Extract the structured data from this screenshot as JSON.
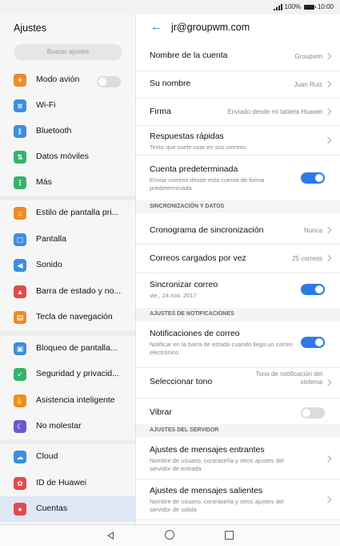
{
  "status": {
    "battery": "100%",
    "time": "10:00"
  },
  "left": {
    "title": "Ajustes",
    "search_placeholder": "Buscar ajustes",
    "items": [
      {
        "label": "Modo avión",
        "icon": "airplane-icon",
        "color": "#f08a24"
      },
      {
        "label": "Wi-Fi",
        "icon": "wifi-icon",
        "color": "#3b8fe0"
      },
      {
        "label": "Bluetooth",
        "icon": "bluetooth-icon",
        "color": "#3b8fe0"
      },
      {
        "label": "Datos móviles",
        "icon": "mobile-data-icon",
        "color": "#32b36b"
      },
      {
        "label": "Más",
        "icon": "more-icon",
        "color": "#32b36b"
      },
      {
        "label": "Estilo de pantalla pri...",
        "icon": "home-style-icon",
        "color": "#f08a24"
      },
      {
        "label": "Pantalla",
        "icon": "display-icon",
        "color": "#3b8fe0"
      },
      {
        "label": "Sonido",
        "icon": "sound-icon",
        "color": "#3b8fe0"
      },
      {
        "label": "Barra de estado y no...",
        "icon": "notification-icon",
        "color": "#e5484d"
      },
      {
        "label": "Tecla de navegación",
        "icon": "navigation-key-icon",
        "color": "#f08a24"
      },
      {
        "label": "Bloqueo de pantalla...",
        "icon": "lock-icon",
        "color": "#3b8fe0"
      },
      {
        "label": "Seguridad y privacid...",
        "icon": "security-icon",
        "color": "#32b36b"
      },
      {
        "label": "Asistencia inteligente",
        "icon": "hand-icon",
        "color": "#f08a24"
      },
      {
        "label": "No molestar",
        "icon": "moon-icon",
        "color": "#6a5acd"
      },
      {
        "label": "Cloud",
        "icon": "cloud-icon",
        "color": "#3b8fe0"
      },
      {
        "label": "ID de Huawei",
        "icon": "huawei-icon",
        "color": "#e5484d"
      },
      {
        "label": "Cuentas",
        "icon": "account-icon",
        "color": "#e5484d"
      }
    ]
  },
  "account": {
    "email": "jr@groupwm.com",
    "rows": {
      "account_name": {
        "title": "Nombre de la cuenta",
        "value": "Groupwm"
      },
      "your_name": {
        "title": "Su nombre",
        "value": "Juan Ruiz"
      },
      "signature": {
        "title": "Firma",
        "value": "Enviado desde mi tableta Huawei"
      },
      "quick_replies": {
        "title": "Respuestas rápidas",
        "sub": "Texto que suele usar en sus correos"
      },
      "default_account": {
        "title": "Cuenta predeterminada",
        "sub": "Enviar correos desde esta cuenta de forma predeterminada"
      },
      "sync_section": "SINCRONIZACIÓN Y DATOS",
      "sync_schedule": {
        "title": "Cronograma de sincronización",
        "value": "Nunca"
      },
      "emails_loaded": {
        "title": "Correos cargados por vez",
        "value": "25 correos"
      },
      "sync_mail": {
        "title": "Sincronizar correo",
        "sub": "vie., 24 nov. 2017"
      },
      "notif_section": "AJUSTES DE NOTIFICACIONES",
      "mail_notif": {
        "title": "Notificaciones de correo",
        "sub": "Notificar en la barra de estado cuando llega un correo electrónico"
      },
      "select_tone": {
        "title": "Seleccionar tono",
        "value": "Tono de notificación del sistema"
      },
      "vibrate": {
        "title": "Vibrar"
      },
      "server_section": "AJUSTES DEL SERVIDOR",
      "incoming": {
        "title": "Ajustes de mensajes entrantes",
        "sub": "Nombre de usuario, contraseña y otros ajustes del servidor de entrada"
      },
      "outgoing": {
        "title": "Ajustes de mensajes salientes",
        "sub": "Nombre de usuario, contraseña y otros ajustes del servidor de salida"
      }
    }
  }
}
